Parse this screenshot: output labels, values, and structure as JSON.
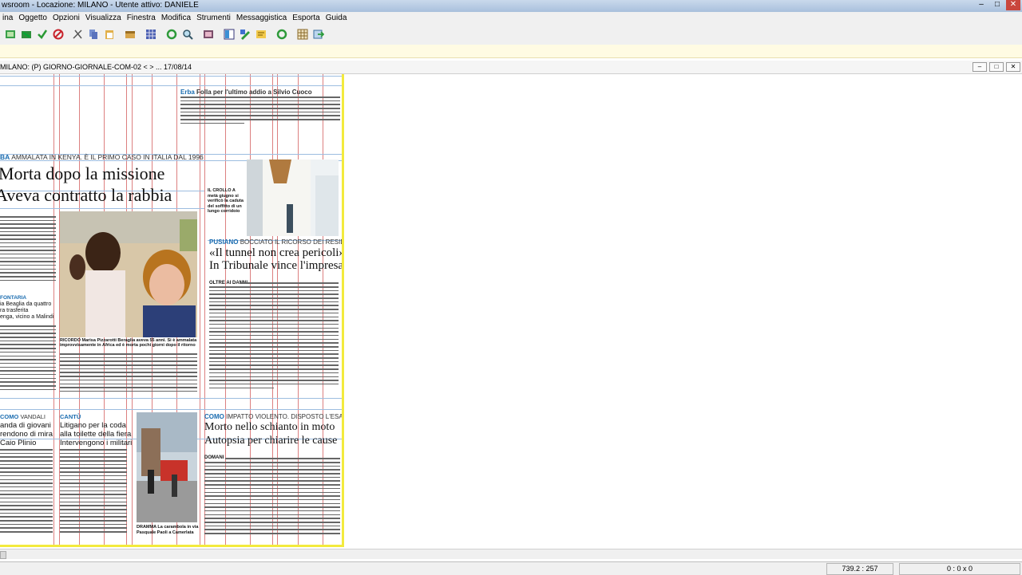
{
  "window": {
    "title": "wsroom - Locazione: MILANO - Utente attivo: DANIELE"
  },
  "menu": [
    "ina",
    "Oggetto",
    "Opzioni",
    "Visualizza",
    "Finestra",
    "Modifica",
    "Strumenti",
    "Messaggistica",
    "Esporta",
    "Guida"
  ],
  "toolbar_icons": [
    "new-page-icon",
    "open-icon",
    "check-icon",
    "cancel-icon",
    "cut-icon",
    "copy-icon",
    "paste-icon",
    "box-icon",
    "grid-icon",
    "refresh-icon",
    "zoom-icon",
    "image-icon",
    "layout-icon",
    "edit-icon",
    "note-icon",
    "sync-icon",
    "table-icon",
    "export-icon"
  ],
  "document": {
    "label": "MILANO: (P) GIORNO-GIORNALE-COM-02 < > ... 17/08/14"
  },
  "articles": {
    "erba": {
      "kicker": "Erba",
      "title": "Folla per l'ultimo addio a Silvio Cuoco"
    },
    "main": {
      "kicker_place": "BA",
      "kicker_text": "AMMALATA IN KENYA. È IL PRIMO CASO IN ITALIA DAL 1996",
      "title1": "Morta dopo la missione",
      "title2": "Aveva contratto la rabbia",
      "caption": "RICORDO Marisa Pizzarotti Beraglia aveva 55 anni. Si è ammalata improvvisamente in Africa ed è morta pochi giorni dopo il ritorno"
    },
    "crollo": {
      "caption": "IL CROLLO A metà giugno si verificò la caduta del soffitto di un lungo corridoio"
    },
    "pusiano": {
      "kicker_place": "PUSIANO",
      "kicker_text": "BOCCIATO IL RICORSO DEI RESIDENTI",
      "title1": "«Il tunnel non crea pericoli»",
      "title2": "In Tribunale vince l'impresa",
      "lead": "OLTRE AI DANNI"
    },
    "fontaria": {
      "kicker": "FONTARIA",
      "text1": "ia Beaglia da quattro",
      "text2": "ra trasferita",
      "text3": "enga, vicino a Malindi"
    },
    "vandali": {
      "kicker_place": "COMO",
      "kicker_text": "VANDALI",
      "title1": "anda di giovani",
      "title2": "rendono di mira",
      "title3": "Caio Plinio"
    },
    "cantu": {
      "kicker": "CANTÙ",
      "title1": "Litigano per la coda",
      "title2": "alla toilette della fiera",
      "title3": "Intervengono i militari",
      "caption": "DRAMMA La carambola in via Pasquale Paoli a Camerlata"
    },
    "incidente": {
      "kicker_place": "COMO",
      "kicker_text": "IMPATTO VIOLENTO. DISPOSTO L'ESAME",
      "title1": "Morto nello schianto in moto",
      "title2": "Autopsia per chiarire le cause",
      "lead": "DOMANI"
    }
  },
  "status": {
    "coords": "739.2 : 257",
    "selection": "0 : 0 x 0"
  }
}
